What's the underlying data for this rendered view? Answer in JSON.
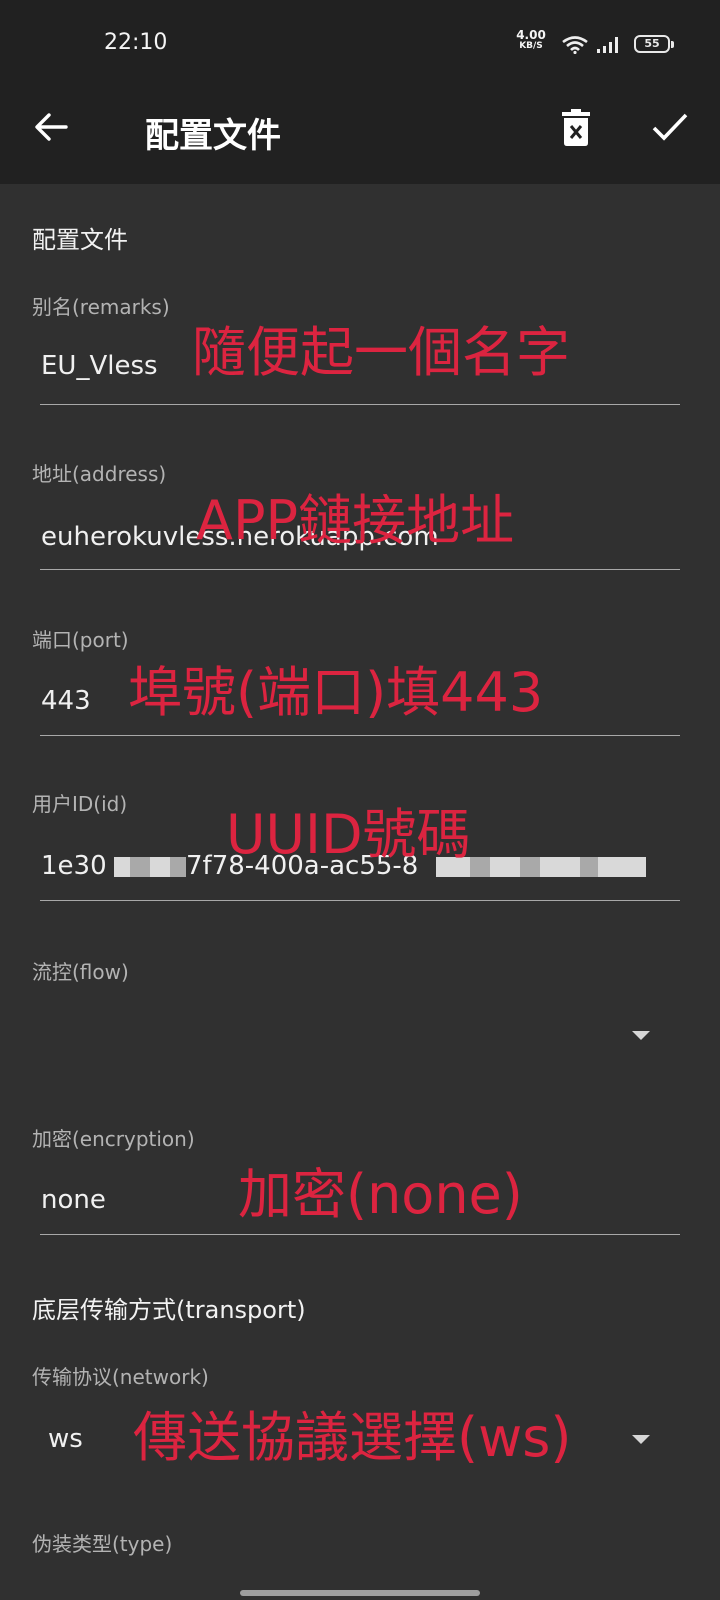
{
  "status_bar": {
    "time": "22:10",
    "net_speed_value": "4.00",
    "net_speed_unit": "KB/S",
    "battery": "55"
  },
  "app_bar": {
    "title": "配置文件",
    "back_icon": "arrow-left-icon",
    "delete_icon": "delete-icon",
    "save_icon": "check-icon"
  },
  "section_profile": "配置文件",
  "fields": {
    "remarks": {
      "label": "别名(remarks)",
      "value": "EU_Vless"
    },
    "address": {
      "label": "地址(address)",
      "value": "euherokuvless.herokuapp.com"
    },
    "port": {
      "label": "端口(port)",
      "value": "443"
    },
    "id": {
      "label": "用户ID(id)",
      "value_start": "1e30",
      "value_mid": "7f78-400a-ac55-8"
    },
    "flow": {
      "label": "流控(flow)",
      "value": ""
    },
    "encryption": {
      "label": "加密(encryption)",
      "value": "none"
    }
  },
  "section_transport": "底层传输方式(transport)",
  "network": {
    "label": "传输协议(network)",
    "value": "ws"
  },
  "type": {
    "label": "伪装类型(type)"
  },
  "annotations": {
    "remarks": "隨便起一個名字",
    "address": "APP鏈接地址",
    "port": "埠號(端口)填443",
    "id": "UUID號碼",
    "encryption": "加密(none)",
    "network": "傳送協議選擇(ws)"
  },
  "colors": {
    "background": "#303030",
    "toolbar": "#212121",
    "annotation": "#dc2440"
  }
}
